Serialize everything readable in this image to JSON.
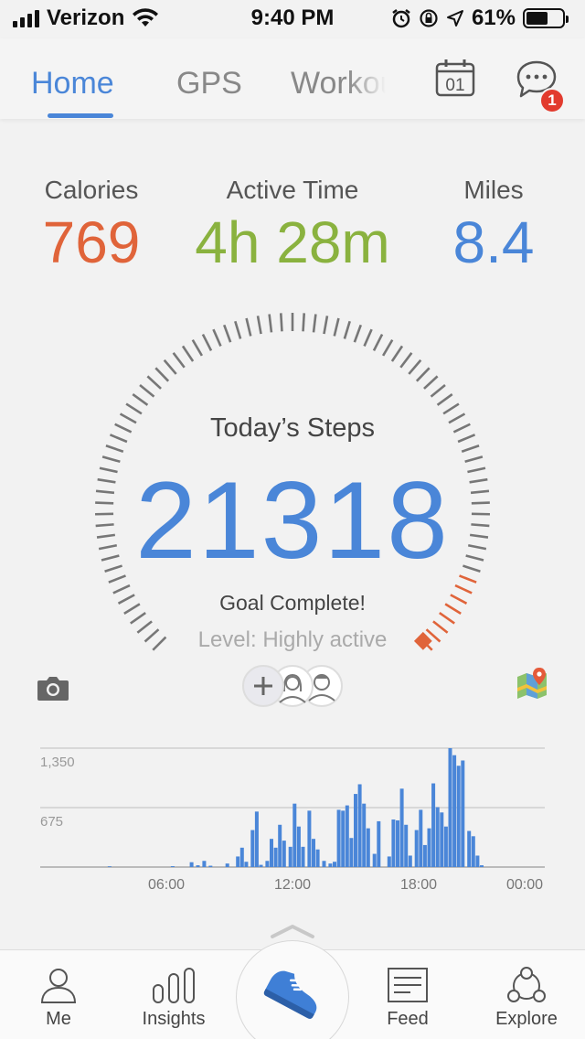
{
  "status_bar": {
    "carrier": "Verizon",
    "time": "9:40 PM",
    "battery": "61%",
    "battery_level": 0.61
  },
  "top_nav": {
    "tabs": [
      {
        "label": "Home",
        "active": true
      },
      {
        "label": "GPS",
        "active": false
      },
      {
        "label": "Workouts",
        "active": false
      }
    ],
    "calendar_day": "01",
    "chat_badge": "1"
  },
  "stats": {
    "calories": {
      "label": "Calories",
      "value": "769",
      "color": "#e0643a"
    },
    "active_time": {
      "label": "Active Time",
      "value": "4h 28m",
      "color": "#8ab23f"
    },
    "miles": {
      "label": "Miles",
      "value": "8.4",
      "color": "#4a86d8"
    }
  },
  "steps": {
    "label": "Today’s Steps",
    "value": "21318",
    "goal_text": "Goal Complete!",
    "level_text": "Level: Highly active"
  },
  "icons": {
    "camera": "camera-icon",
    "friends": "friends-avatars",
    "map": "map-pin-icon"
  },
  "chart_data": {
    "type": "bar",
    "y_ticks": [
      "1,350",
      "675"
    ],
    "x_ticks": [
      "06:00",
      "12:00",
      "18:00",
      "00:00"
    ],
    "ylim": [
      0,
      1350
    ],
    "xlim": [
      0,
      24
    ],
    "bar_color": "#4a86d8",
    "values": [
      {
        "t": 3.3,
        "v": 8
      },
      {
        "t": 6.3,
        "v": 10
      },
      {
        "t": 7.2,
        "v": 55
      },
      {
        "t": 7.5,
        "v": 20
      },
      {
        "t": 7.8,
        "v": 70
      },
      {
        "t": 8.1,
        "v": 15
      },
      {
        "t": 8.9,
        "v": 40
      },
      {
        "t": 9.4,
        "v": 120
      },
      {
        "t": 9.6,
        "v": 220
      },
      {
        "t": 9.8,
        "v": 60
      },
      {
        "t": 10.1,
        "v": 420
      },
      {
        "t": 10.3,
        "v": 630
      },
      {
        "t": 10.5,
        "v": 25
      },
      {
        "t": 10.8,
        "v": 70
      },
      {
        "t": 11.0,
        "v": 320
      },
      {
        "t": 11.2,
        "v": 220
      },
      {
        "t": 11.4,
        "v": 480
      },
      {
        "t": 11.6,
        "v": 300
      },
      {
        "t": 11.9,
        "v": 230
      },
      {
        "t": 12.1,
        "v": 720
      },
      {
        "t": 12.3,
        "v": 460
      },
      {
        "t": 12.5,
        "v": 230
      },
      {
        "t": 12.8,
        "v": 640
      },
      {
        "t": 13.0,
        "v": 320
      },
      {
        "t": 13.2,
        "v": 200
      },
      {
        "t": 13.5,
        "v": 70
      },
      {
        "t": 13.8,
        "v": 40
      },
      {
        "t": 14.0,
        "v": 60
      },
      {
        "t": 14.2,
        "v": 650
      },
      {
        "t": 14.4,
        "v": 640
      },
      {
        "t": 14.6,
        "v": 700
      },
      {
        "t": 14.8,
        "v": 330
      },
      {
        "t": 15.0,
        "v": 830
      },
      {
        "t": 15.2,
        "v": 940
      },
      {
        "t": 15.4,
        "v": 720
      },
      {
        "t": 15.6,
        "v": 440
      },
      {
        "t": 15.9,
        "v": 150
      },
      {
        "t": 16.1,
        "v": 520
      },
      {
        "t": 16.6,
        "v": 120
      },
      {
        "t": 16.8,
        "v": 540
      },
      {
        "t": 17.0,
        "v": 530
      },
      {
        "t": 17.2,
        "v": 890
      },
      {
        "t": 17.4,
        "v": 480
      },
      {
        "t": 17.6,
        "v": 130
      },
      {
        "t": 17.9,
        "v": 420
      },
      {
        "t": 18.1,
        "v": 650
      },
      {
        "t": 18.3,
        "v": 250
      },
      {
        "t": 18.5,
        "v": 440
      },
      {
        "t": 18.7,
        "v": 950
      },
      {
        "t": 18.9,
        "v": 680
      },
      {
        "t": 19.1,
        "v": 620
      },
      {
        "t": 19.3,
        "v": 460
      },
      {
        "t": 19.5,
        "v": 1350
      },
      {
        "t": 19.7,
        "v": 1270
      },
      {
        "t": 19.9,
        "v": 1150
      },
      {
        "t": 20.1,
        "v": 1210
      },
      {
        "t": 20.4,
        "v": 410
      },
      {
        "t": 20.6,
        "v": 350
      },
      {
        "t": 20.8,
        "v": 130
      },
      {
        "t": 21.0,
        "v": 20
      }
    ]
  },
  "bottom_nav": {
    "items": [
      {
        "label": "Me",
        "icon": "person-icon"
      },
      {
        "label": "Insights",
        "icon": "bar-chart-icon"
      },
      {
        "label": "",
        "icon": "sneaker-icon"
      },
      {
        "label": "Feed",
        "icon": "feed-icon"
      },
      {
        "label": "Explore",
        "icon": "group-icon"
      }
    ]
  }
}
